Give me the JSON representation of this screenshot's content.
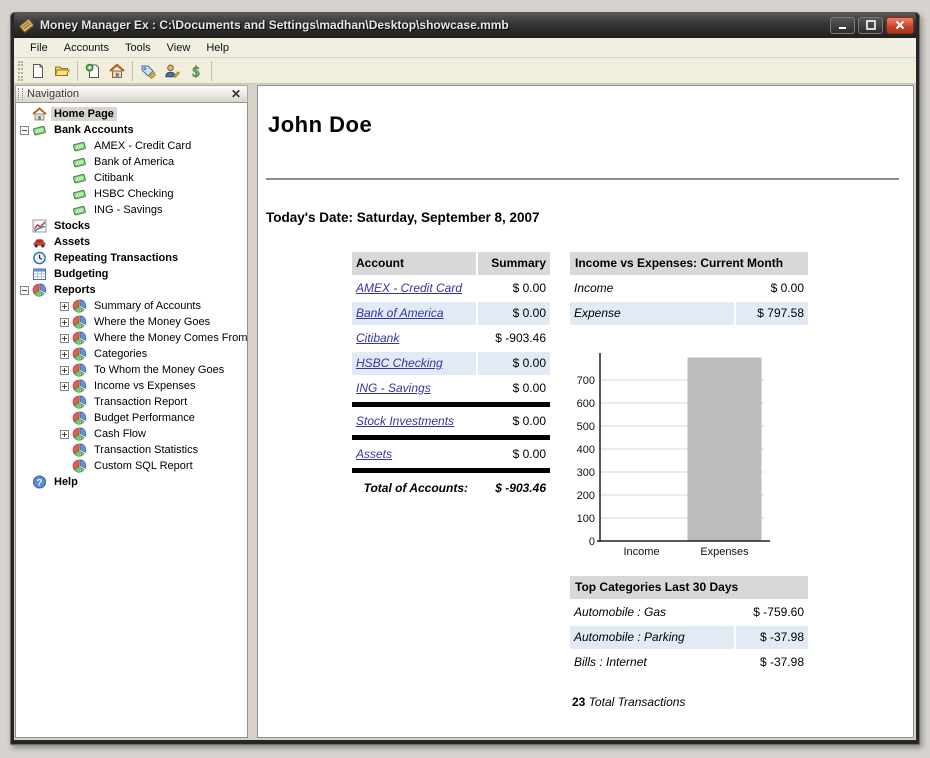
{
  "window": {
    "title": "Money Manager Ex : C:\\Documents and Settings\\madhan\\Desktop\\showcase.mmb"
  },
  "menu": {
    "items": [
      "File",
      "Accounts",
      "Tools",
      "View",
      "Help"
    ]
  },
  "toolbar": {
    "items": [
      "new-file-icon",
      "open-folder-icon",
      "|",
      "new-account-icon",
      "home-icon",
      "|",
      "categories-icon",
      "payees-icon",
      "currency-icon",
      "|"
    ]
  },
  "navigation": {
    "title": "Navigation",
    "tree": [
      {
        "label": "Home Page",
        "level": 0,
        "icon": "home",
        "bold": true,
        "toggle": null,
        "selected": true
      },
      {
        "label": "Bank Accounts",
        "level": 0,
        "icon": "bank",
        "bold": true,
        "toggle": "minus",
        "selected": false
      },
      {
        "label": "AMEX - Credit Card",
        "level": 1,
        "icon": "bank",
        "bold": false,
        "toggle": null,
        "selected": false
      },
      {
        "label": "Bank of America",
        "level": 1,
        "icon": "bank",
        "bold": false,
        "toggle": null,
        "selected": false
      },
      {
        "label": "Citibank",
        "level": 1,
        "icon": "bank",
        "bold": false,
        "toggle": null,
        "selected": false
      },
      {
        "label": "HSBC Checking",
        "level": 1,
        "icon": "bank",
        "bold": false,
        "toggle": null,
        "selected": false
      },
      {
        "label": "ING - Savings",
        "level": 1,
        "icon": "bank",
        "bold": false,
        "toggle": null,
        "selected": false
      },
      {
        "label": "Stocks",
        "level": 0,
        "icon": "stocks",
        "bold": true,
        "toggle": null,
        "selected": false
      },
      {
        "label": "Assets",
        "level": 0,
        "icon": "assets",
        "bold": true,
        "toggle": null,
        "selected": false
      },
      {
        "label": "Repeating Transactions",
        "level": 0,
        "icon": "repeat",
        "bold": true,
        "toggle": null,
        "selected": false
      },
      {
        "label": "Budgeting",
        "level": 0,
        "icon": "budget",
        "bold": true,
        "toggle": null,
        "selected": false
      },
      {
        "label": "Reports",
        "level": 0,
        "icon": "report",
        "bold": true,
        "toggle": "minus",
        "selected": false
      },
      {
        "label": "Summary of Accounts",
        "level": 1,
        "icon": "report",
        "bold": false,
        "toggle": "plus",
        "selected": false
      },
      {
        "label": "Where the Money Goes",
        "level": 1,
        "icon": "report",
        "bold": false,
        "toggle": "plus",
        "selected": false
      },
      {
        "label": "Where the Money Comes From",
        "level": 1,
        "icon": "report",
        "bold": false,
        "toggle": "plus",
        "selected": false
      },
      {
        "label": "Categories",
        "level": 1,
        "icon": "report",
        "bold": false,
        "toggle": "plus",
        "selected": false
      },
      {
        "label": "To Whom the Money Goes",
        "level": 1,
        "icon": "report",
        "bold": false,
        "toggle": "plus",
        "selected": false
      },
      {
        "label": "Income vs Expenses",
        "level": 1,
        "icon": "report",
        "bold": false,
        "toggle": "plus",
        "selected": false
      },
      {
        "label": "Transaction Report",
        "level": 1,
        "icon": "report",
        "bold": false,
        "toggle": null,
        "selected": false
      },
      {
        "label": "Budget Performance",
        "level": 1,
        "icon": "report",
        "bold": false,
        "toggle": null,
        "selected": false
      },
      {
        "label": "Cash Flow",
        "level": 1,
        "icon": "report",
        "bold": false,
        "toggle": "plus",
        "selected": false
      },
      {
        "label": "Transaction Statistics",
        "level": 1,
        "icon": "report",
        "bold": false,
        "toggle": null,
        "selected": false
      },
      {
        "label": "Custom SQL Report",
        "level": 1,
        "icon": "report",
        "bold": false,
        "toggle": null,
        "selected": false
      },
      {
        "label": "Help",
        "level": 0,
        "icon": "help",
        "bold": true,
        "toggle": null,
        "selected": false
      }
    ]
  },
  "main": {
    "owner": "John Doe",
    "date_line": "Today's Date: Saturday, September 8, 2007",
    "accounts_table": {
      "headers": [
        "Account",
        "Summary"
      ],
      "rows": [
        {
          "type": "account",
          "label": "AMEX - Credit Card",
          "value": "$ 0.00",
          "alt": false
        },
        {
          "type": "account",
          "label": "Bank of America",
          "value": "$ 0.00",
          "alt": true
        },
        {
          "type": "account",
          "label": "Citibank",
          "value": "$ -903.46",
          "alt": false
        },
        {
          "type": "account",
          "label": "HSBC Checking",
          "value": "$ 0.00",
          "alt": true
        },
        {
          "type": "account",
          "label": "ING - Savings",
          "value": "$ 0.00",
          "alt": false
        },
        {
          "type": "separator"
        },
        {
          "type": "account",
          "label": "Stock Investments",
          "value": "$ 0.00",
          "alt": false
        },
        {
          "type": "separator"
        },
        {
          "type": "account",
          "label": "Assets",
          "value": "$ 0.00",
          "alt": false
        },
        {
          "type": "separator"
        }
      ],
      "total_label": "Total of Accounts:",
      "total_value": "$ -903.46"
    },
    "income_expenses": {
      "title": "Income vs Expenses: Current Month",
      "rows": [
        {
          "label": "Income",
          "value": "$ 0.00",
          "alt": false
        },
        {
          "label": "Expense",
          "value": "$ 797.58",
          "alt": true
        }
      ]
    },
    "top_categories": {
      "title": "Top Categories Last 30 Days",
      "rows": [
        {
          "label": "Automobile : Gas",
          "value": "$ -759.60",
          "alt": false
        },
        {
          "label": "Automobile : Parking",
          "value": "$ -37.98",
          "alt": true
        },
        {
          "label": "Bills : Internet",
          "value": "$ -37.98",
          "alt": false
        }
      ]
    },
    "transactions": {
      "count": "23",
      "label": "Total Transactions"
    }
  },
  "chart_data": {
    "type": "bar",
    "title": "",
    "categories": [
      "Income",
      "Expenses"
    ],
    "values": [
      0,
      797.58
    ],
    "yticks": [
      0,
      100,
      200,
      300,
      400,
      500,
      600,
      700
    ],
    "ylim": [
      0,
      800
    ],
    "xlabel": "",
    "ylabel": "",
    "grid": true,
    "legend": "none",
    "bar_color": "#bcbcbc",
    "grid_color": "#d6d6d6"
  },
  "colors": {
    "titlebar": "#333333",
    "close_button": "#c44427",
    "table_header_bg": "#d8d8d8",
    "row_alt_bg": "#e1eaf5",
    "link": "#3434a2",
    "separator": "#000000"
  }
}
